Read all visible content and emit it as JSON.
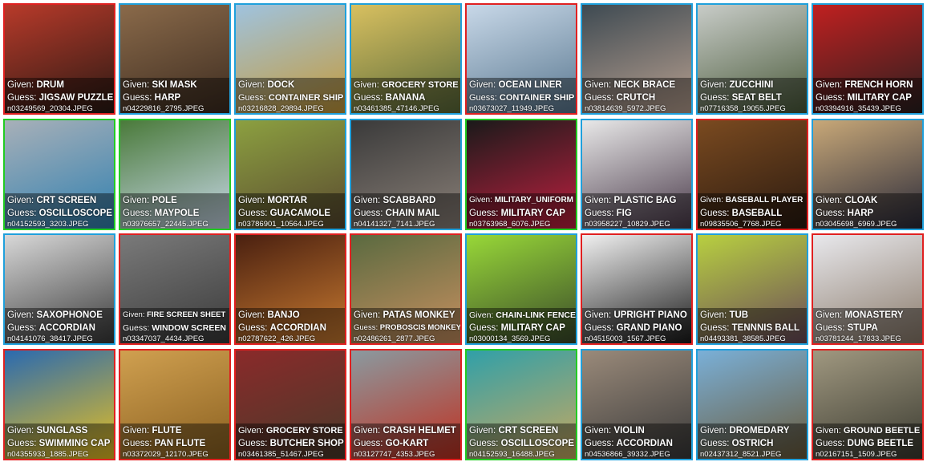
{
  "given_prefix": "Given: ",
  "guess_prefix": "Guess: ",
  "colors": {
    "wrong": "#e02020",
    "correct": "#22cc22",
    "plausible": "#1fa0dc"
  },
  "tiles": [
    {
      "given": "DRUM",
      "guess": "JIGSAW PUZZLE",
      "file": "n03249569_20304.JPEG",
      "status": "wrong",
      "bg": [
        "#b83a2a",
        "#2b1a14"
      ]
    },
    {
      "given": "SKI MASK",
      "guess": "HARP",
      "file": "n04229816_2795.JPEG",
      "status": "plausible",
      "bg": [
        "#8a6a4a",
        "#3d2c20"
      ]
    },
    {
      "given": "DOCK",
      "guess": "CONTAINER SHIP",
      "file": "n03216828_29894.JPEG",
      "status": "plausible",
      "bg": [
        "#9fc3df",
        "#c59a3a"
      ]
    },
    {
      "given": "GROCERY STORE",
      "guess": "BANANA",
      "file": "n03461385_47146.JPEG",
      "status": "plausible",
      "bg": [
        "#d8c060",
        "#5a6a3a"
      ]
    },
    {
      "given": "OCEAN LINER",
      "guess": "CONTAINER SHIP",
      "file": "n03673027_11949.JPEG",
      "status": "wrong",
      "bg": [
        "#c8d8e8",
        "#5a7890"
      ]
    },
    {
      "given": "NECK BRACE",
      "guess": "CRUTCH",
      "file": "n03814639_5972.JPEG",
      "status": "plausible",
      "bg": [
        "#3e4a52",
        "#b8a090"
      ]
    },
    {
      "given": "ZUCCHINI",
      "guess": "SEAT BELT",
      "file": "n07716358_19055.JPEG",
      "status": "plausible",
      "bg": [
        "#c8ccc8",
        "#4a5a3a"
      ]
    },
    {
      "given": "FRENCH HORN",
      "guess": "MILITARY CAP",
      "file": "n03394916_35439.JPEG",
      "status": "plausible",
      "bg": [
        "#c02020",
        "#2a2020"
      ]
    },
    {
      "given": "CRT SCREEN",
      "guess": "OSCILLOSCOPE",
      "file": "n04152593_3203.JPEG",
      "status": "correct",
      "bg": [
        "#a8b0b8",
        "#3080b0"
      ]
    },
    {
      "given": "POLE",
      "guess": "MAYPOLE",
      "file": "n03976657_22445.JPEG",
      "status": "correct",
      "bg": [
        "#4a7a3a",
        "#c8d8e8"
      ]
    },
    {
      "given": "MORTAR",
      "guess": "GUACAMOLE",
      "file": "n03786901_10564.JPEG",
      "status": "plausible",
      "bg": [
        "#8ca040",
        "#5a4a30"
      ]
    },
    {
      "given": "SCABBARD",
      "guess": "CHAIN MAIL",
      "file": "n04141327_7141.JPEG",
      "status": "plausible",
      "bg": [
        "#3a3a3a",
        "#8a8078"
      ]
    },
    {
      "given": "MILITARY_UNIFORM",
      "guess": "MILITARY CAP",
      "file": "n03763968_6076.JPEG",
      "status": "correct",
      "bg": [
        "#1a1a1a",
        "#c02040"
      ]
    },
    {
      "given": "PLASTIC BAG",
      "guess": "FIG",
      "file": "n03958227_10829.JPEG",
      "status": "plausible",
      "bg": [
        "#e8e8e8",
        "#4a3a4a"
      ]
    },
    {
      "given": "BASEBALL PLAYER",
      "guess": "BASEBALL",
      "file": "n09835506_7768.JPEG",
      "status": "wrong",
      "bg": [
        "#7a4a20",
        "#2a1a10"
      ]
    },
    {
      "given": "CLOAK",
      "guess": "HARP",
      "file": "n03045698_6969.JPEG",
      "status": "plausible",
      "bg": [
        "#c8a878",
        "#2a2a3a"
      ]
    },
    {
      "given": "SAXOPHONOE",
      "guess": "ACCORDIAN",
      "file": "n04141076_38417.JPEG",
      "status": "plausible",
      "bg": [
        "#d8d8d8",
        "#3a3a3a"
      ]
    },
    {
      "given": "FIRE SCREEN SHEET",
      "guess": "WINDOW SCREEN",
      "file": "n03347037_4434.JPEG",
      "status": "wrong",
      "bg": [
        "#7a7a7a",
        "#3a3a3a"
      ]
    },
    {
      "given": "BANJO",
      "guess": "ACCORDIAN",
      "file": "n02787622_426.JPEG",
      "status": "wrong",
      "bg": [
        "#4a2010",
        "#c87a30"
      ]
    },
    {
      "given": "PATAS MONKEY",
      "guess": "PROBOSCIS MONKEY",
      "file": "n02486261_2877.JPEG",
      "status": "wrong",
      "bg": [
        "#5a6a40",
        "#c89060"
      ]
    },
    {
      "given": "CHAIN-LINK FENCE",
      "guess": "MILITARY CAP",
      "file": "n03000134_3569.JPEG",
      "status": "plausible",
      "bg": [
        "#98d838",
        "#3a4a2a"
      ]
    },
    {
      "given": "UPRIGHT PIANO",
      "guess": "GRAND PIANO",
      "file": "n04515003_1567.JPEG",
      "status": "wrong",
      "bg": [
        "#f0f0f0",
        "#1a1a1a"
      ]
    },
    {
      "given": "TUB",
      "guess": "TENNNIS BALL",
      "file": "n04493381_38585.JPEG",
      "status": "plausible",
      "bg": [
        "#b8d040",
        "#6a4a5a"
      ]
    },
    {
      "given": "MONASTERY",
      "guess": "STUPA",
      "file": "n03781244_17833.JPEG",
      "status": "wrong",
      "bg": [
        "#e8e8ec",
        "#8a7a6a"
      ]
    },
    {
      "given": "SUNGLASS",
      "guess": "SWIMMING CAP",
      "file": "n04355933_1885.JPEG",
      "status": "wrong",
      "bg": [
        "#2a6ab0",
        "#e8c020"
      ]
    },
    {
      "given": "FLUTE",
      "guess": "PAN FLUTE",
      "file": "n03372029_12170.JPEG",
      "status": "wrong",
      "bg": [
        "#d0a050",
        "#8a6020"
      ]
    },
    {
      "given": "GROCERY STORE",
      "guess": "BUTCHER SHOP",
      "file": "n03461385_51467.JPEG",
      "status": "wrong",
      "bg": [
        "#8a2a2a",
        "#4a3a2a"
      ]
    },
    {
      "given": "CRASH HELMET",
      "guess": "GO-KART",
      "file": "n03127747_4353.JPEG",
      "status": "wrong",
      "bg": [
        "#8a9aa0",
        "#c03020"
      ]
    },
    {
      "given": "CRT SCREEN",
      "guess": "OSCILLOSCOPE",
      "file": "n04152593_16488.JPEG",
      "status": "correct",
      "bg": [
        "#30a0a8",
        "#c8a860"
      ]
    },
    {
      "given": "VIOLIN",
      "guess": "ACCORDIAN",
      "file": "n04536866_39332.JPEG",
      "status": "plausible",
      "bg": [
        "#9a8a7a",
        "#3a3a3a"
      ]
    },
    {
      "given": "DROMEDARY",
      "guess": "OSTRICH",
      "file": "n02437312_8521.JPEG",
      "status": "plausible",
      "bg": [
        "#7ab0d8",
        "#6a5a3a"
      ]
    },
    {
      "given": "GROUND BEETLE",
      "guess": "DUNG BEETLE",
      "file": "n02167151_1509.JPEG",
      "status": "wrong",
      "bg": [
        "#a09880",
        "#3a3a30"
      ]
    }
  ]
}
